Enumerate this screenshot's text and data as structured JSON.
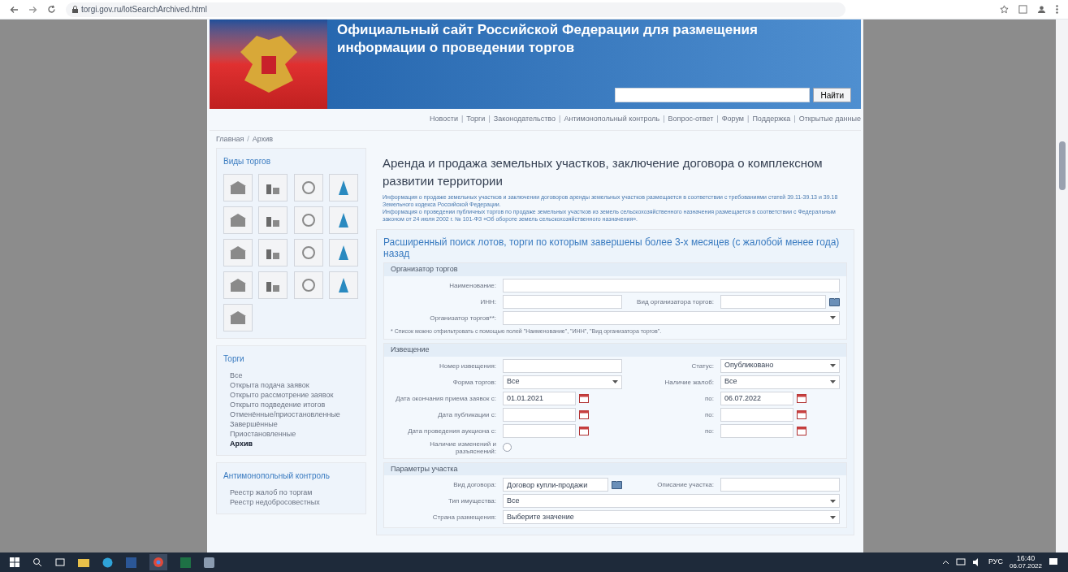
{
  "browser": {
    "url": "torgi.gov.ru/lotSearchArchived.html"
  },
  "header": {
    "title_lines": [
      "Официальный сайт Российской Федерации для размещения",
      "информации о проведении торгов"
    ],
    "search_button": "Найти"
  },
  "nav": [
    "Новости",
    "Торги",
    "Законодательство",
    "Антимонопольный контроль",
    "Вопрос-ответ",
    "Форум",
    "Поддержка",
    "Открытые данные"
  ],
  "nav_separator": "|",
  "breadcrumb": [
    "Главная",
    "Архив"
  ],
  "breadcrumb_separator": "/",
  "sidebar": {
    "types_title": "Виды торгов",
    "torgi": {
      "title": "Торги",
      "items": [
        {
          "label": "Все",
          "selected": false
        },
        {
          "label": "Открыта подача заявок",
          "selected": false
        },
        {
          "label": "Открыто рассмотрение заявок",
          "selected": false
        },
        {
          "label": "Открыто подведение итогов",
          "selected": false
        },
        {
          "label": "Отменённые/приостановленные",
          "selected": false
        },
        {
          "label": "Завершённые",
          "selected": false
        },
        {
          "label": "Приостановленные",
          "selected": false
        },
        {
          "label": "Архив",
          "selected": true
        }
      ]
    },
    "antimonopoly": {
      "title": "Антимонопольный контроль",
      "items": [
        "Реестр жалоб по торгам",
        "Реестр недобросовестных"
      ]
    }
  },
  "main": {
    "title": "Аренда и продажа земельных участков, заключение договора о комплексном развитии территории",
    "notes": [
      "Информация о продаже земельных участков и заключении договоров аренды земельных участков размещается в соответствии с требованиями статей 39.11-39.13 и 39.18 Земельного кодекса Российской Федерации.",
      "Информация о проведении публичных торгов по продаже земельных участков из земель сельскохозяйственного назначения размещается в соответствии с Федеральным законом от 24 июля 2002 г. № 101-ФЗ «Об обороте земель сельскохозяйственного назначения»."
    ],
    "search_title": "Расширенный поиск лотов, торги по которым завершены более 3-х месяцев (с жалобой менее года) назад",
    "sections": [
      {
        "legend": "Организатор торгов",
        "rows": [
          {
            "fields": [
              {
                "label": "Наименование:",
                "kind": "text"
              }
            ]
          },
          {
            "fields": [
              {
                "label": "ИНН:",
                "kind": "text"
              },
              {
                "label": "Вид организатора торгов:",
                "kind": "lookup"
              }
            ]
          },
          {
            "fields": [
              {
                "label": "Организатор торгов**:",
                "kind": "select"
              }
            ]
          }
        ],
        "note": "* Список можно отфильтровать с помощью полей \"Наименование\", \"ИНН\", \"Вид организатора торгов\"."
      },
      {
        "legend": "Извещение",
        "rows": [
          {
            "fields": [
              {
                "label": "Номер извещения:",
                "kind": "text"
              },
              {
                "label": "Статус:",
                "kind": "select",
                "value": "Опубликовано"
              }
            ]
          },
          {
            "fields": [
              {
                "label": "Форма торгов:",
                "kind": "select",
                "value": "Все"
              },
              {
                "label": "Наличие жалоб:",
                "kind": "select",
                "value": "Все"
              }
            ]
          },
          {
            "fields": [
              {
                "label": "Дата окончания приема заявок с:",
                "kind": "date",
                "value": "01.01.2021"
              },
              {
                "label": "по:",
                "kind": "date",
                "value": "06.07.2022"
              }
            ]
          },
          {
            "fields": [
              {
                "label": "Дата публикации с:",
                "kind": "date"
              },
              {
                "label": "по:",
                "kind": "date"
              }
            ]
          },
          {
            "fields": [
              {
                "label": "Дата проведения аукциона с:",
                "kind": "date"
              },
              {
                "label": "по:",
                "kind": "date"
              }
            ]
          },
          {
            "fields": [
              {
                "label": "Наличие изменений и разъяснений:",
                "kind": "checkbox",
                "checked": false
              }
            ]
          }
        ]
      },
      {
        "legend": "Параметры участка",
        "rows": [
          {
            "fields": [
              {
                "label": "Вид договора:",
                "kind": "lookup",
                "value": "Договор купли-продажи"
              },
              {
                "label": "Описание участка:",
                "kind": "text"
              }
            ]
          },
          {
            "fields": [
              {
                "label": "Тип имущества:",
                "kind": "select",
                "value": "Все"
              }
            ]
          },
          {
            "fields": [
              {
                "label": "Страна размещения:",
                "kind": "select",
                "value": "Выберите значение"
              }
            ]
          }
        ]
      }
    ]
  },
  "taskbar": {
    "time": "16:40",
    "date": "06.07.2022",
    "language": "РУС"
  }
}
